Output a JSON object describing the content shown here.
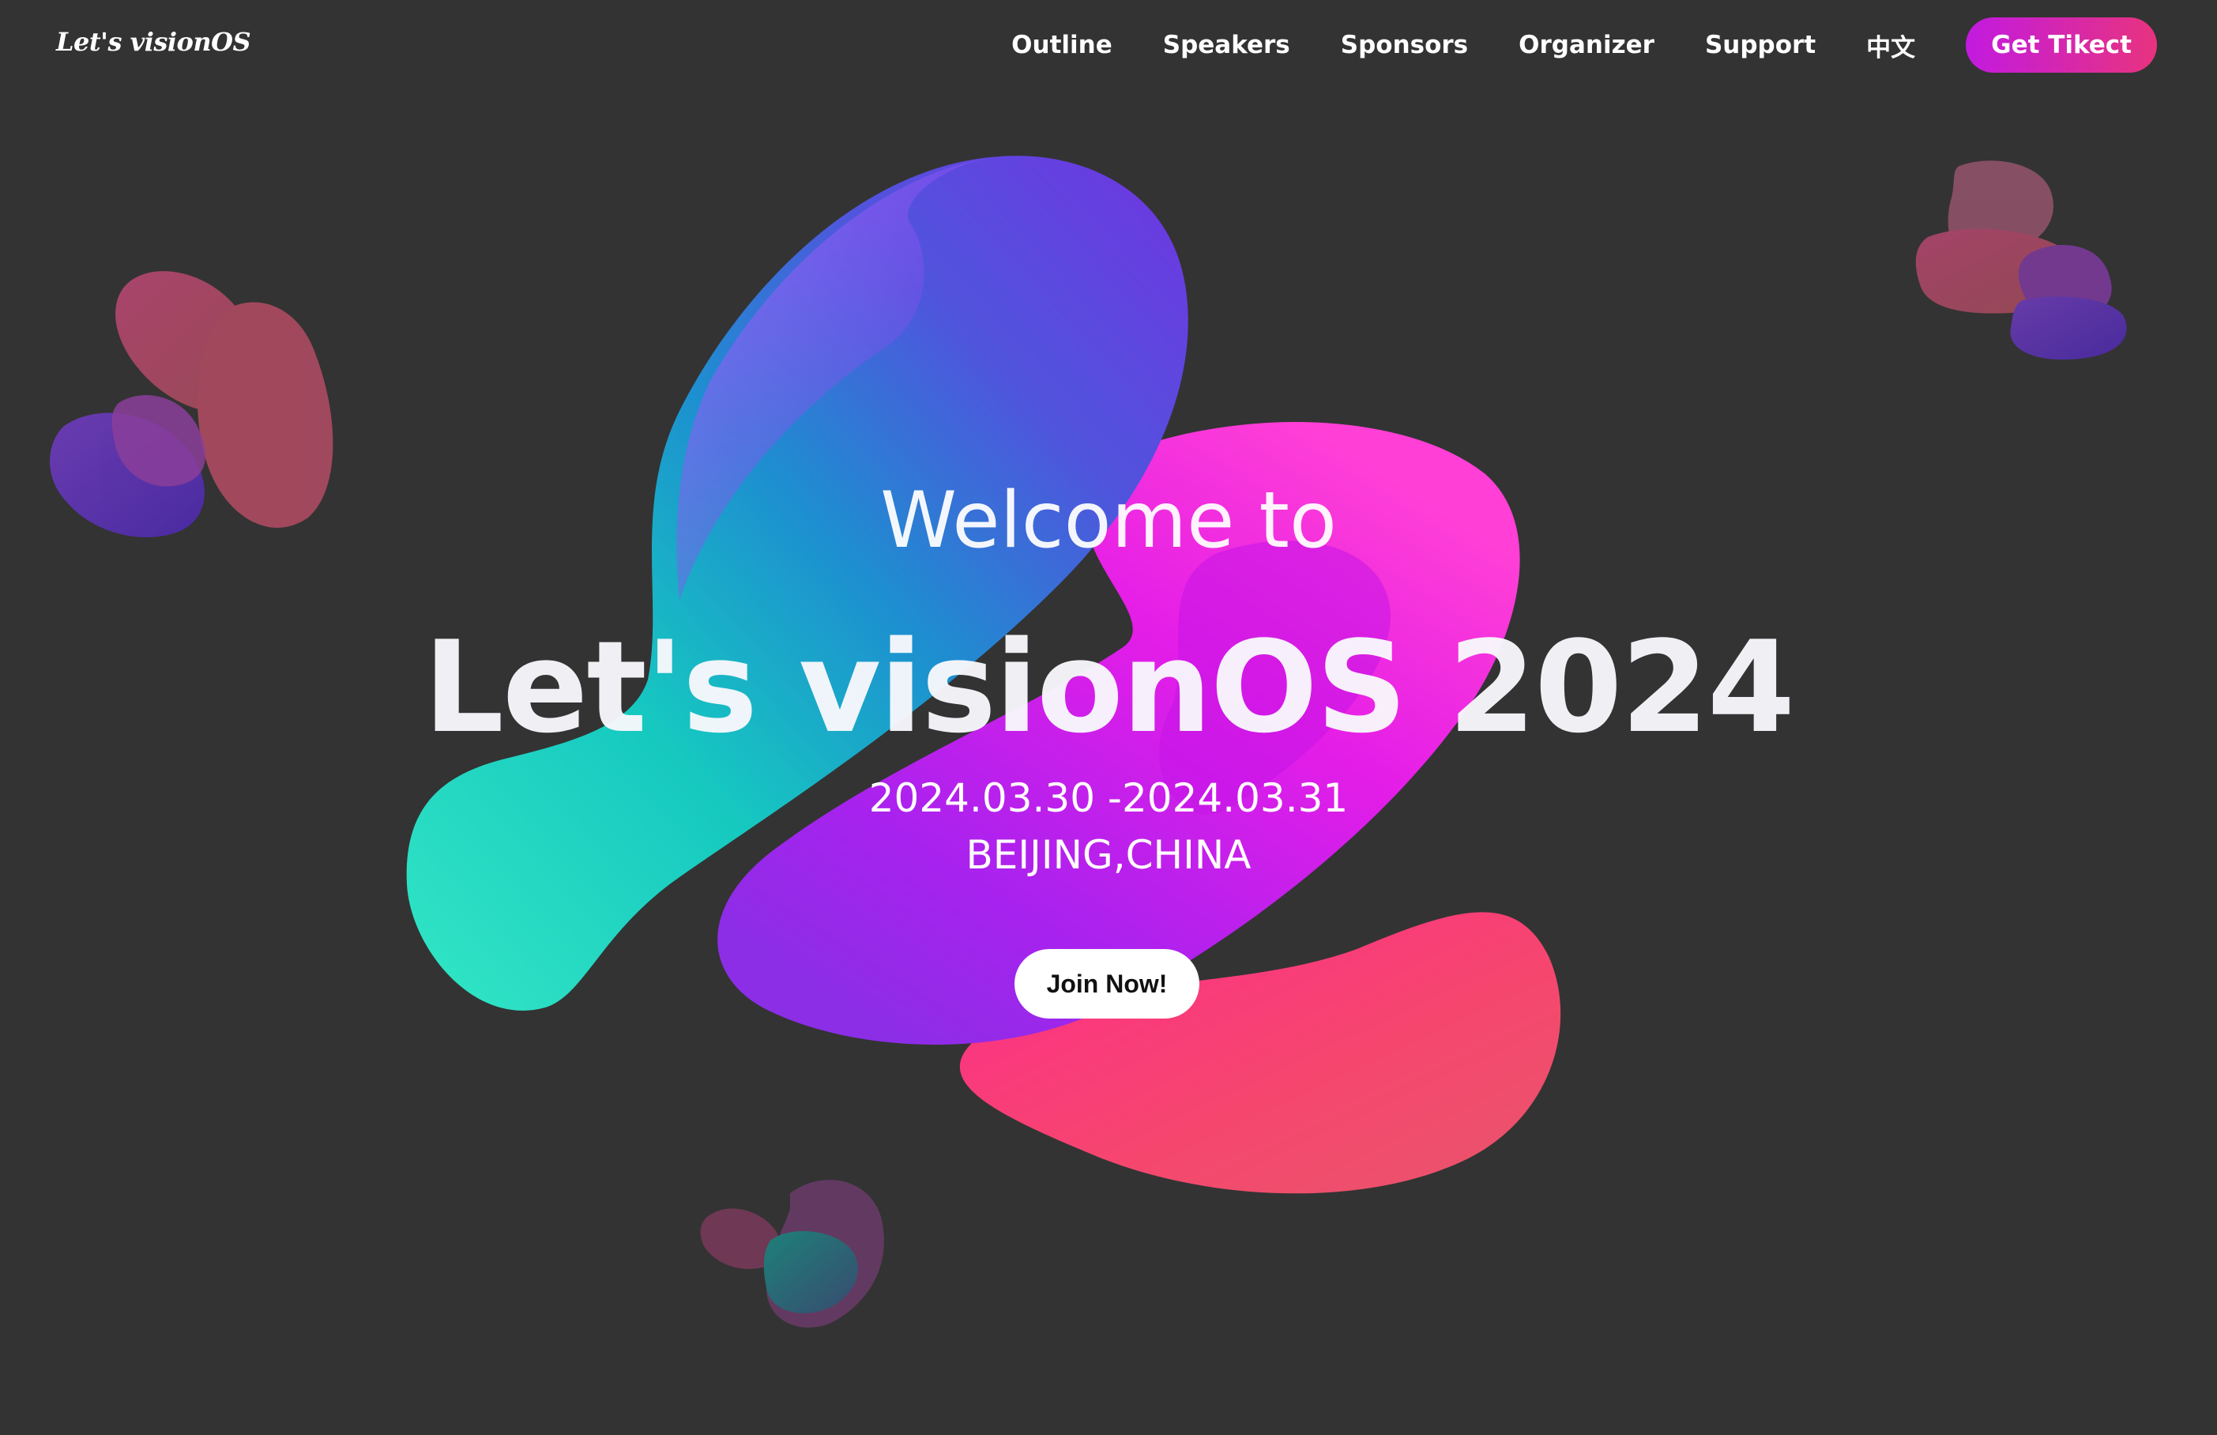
{
  "brand": {
    "logo_text": "Let's visionOS"
  },
  "nav": {
    "items": [
      {
        "label": "Outline"
      },
      {
        "label": "Speakers"
      },
      {
        "label": "Sponsors"
      },
      {
        "label": "Organizer"
      },
      {
        "label": "Support"
      },
      {
        "label": "中文"
      }
    ],
    "cta_label": "Get Tikect"
  },
  "hero": {
    "welcome": "Welcome to",
    "title": "Let's visionOS 2024",
    "dates": "2024.03.30 -2024.03.31",
    "location": "BEIJING,CHINA",
    "join_label": "Join Now!"
  },
  "colors": {
    "background": "#333333",
    "cta_gradient_start": "#c21ae0",
    "cta_gradient_end": "#e8337e",
    "violet": "#8a4dff",
    "teal": "#1fd9c2",
    "magenta": "#e21ae8",
    "coral": "#f0406e"
  },
  "icons": {
    "decorations": [
      "abstract-blob-shape"
    ]
  }
}
